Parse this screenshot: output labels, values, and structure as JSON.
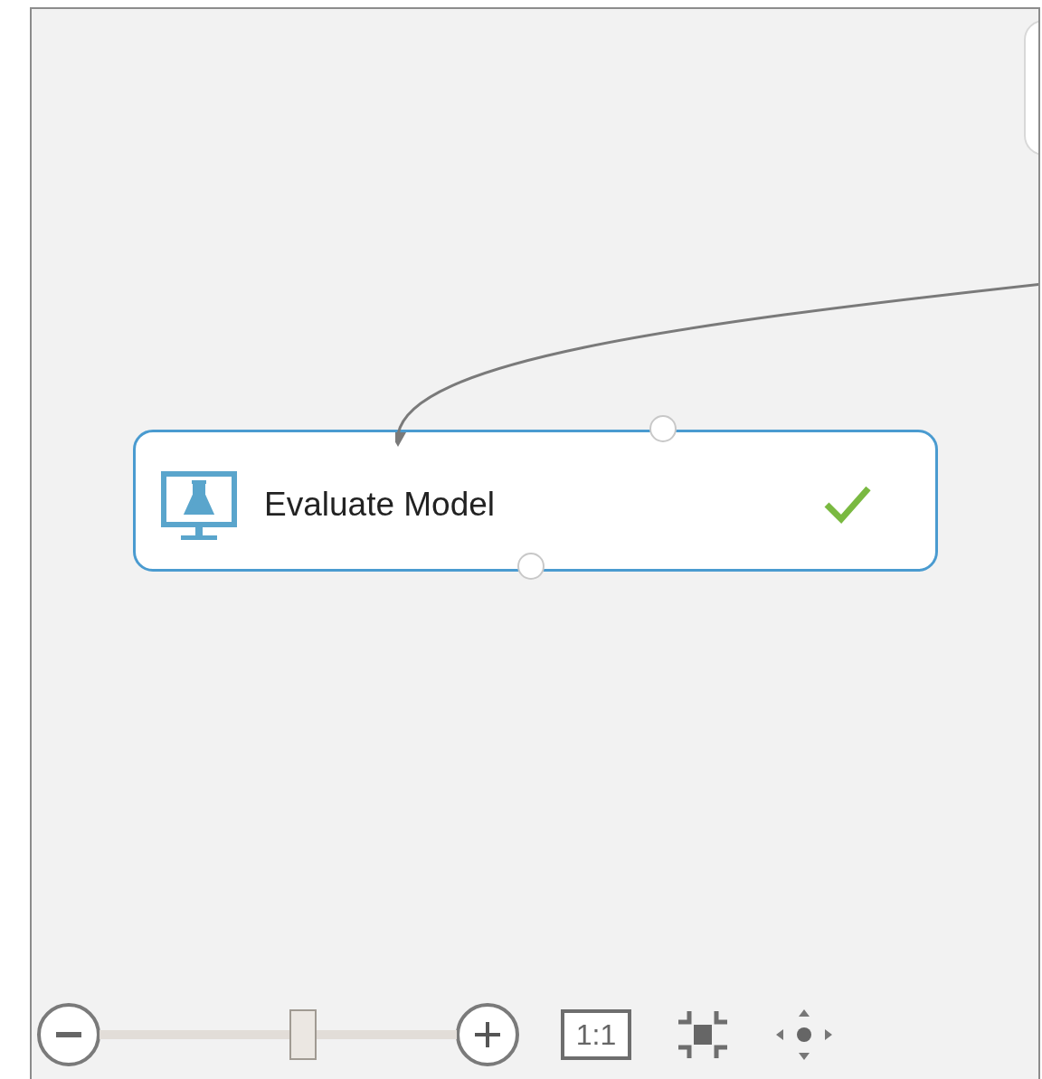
{
  "canvas": {
    "nodes": [
      {
        "label": "Evaluate Model",
        "finished": true
      }
    ]
  },
  "zoom_controls": {
    "level": 0.57,
    "actual_size_label": "1:1"
  }
}
